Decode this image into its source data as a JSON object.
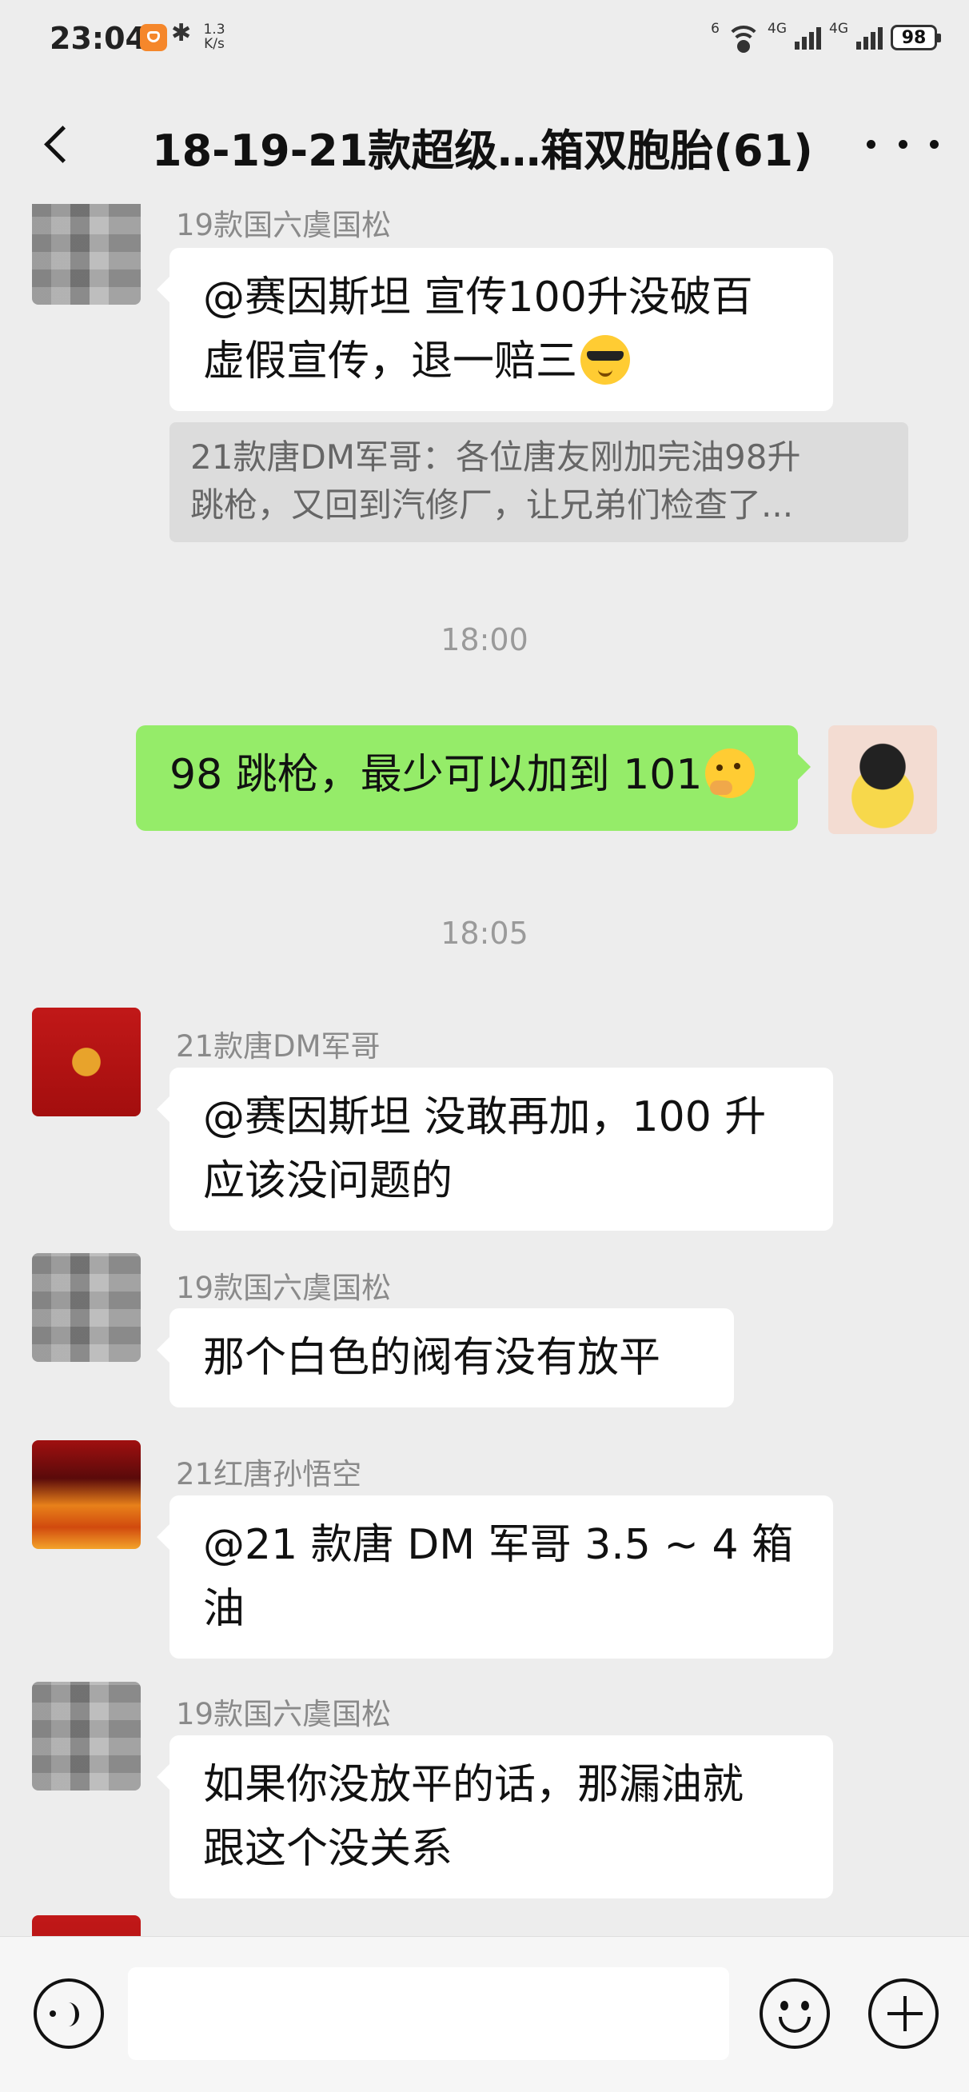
{
  "status_bar": {
    "time": "23:04",
    "net_speed": "1.3\nK/s",
    "net_tag": "6",
    "sim1_tag": "4G",
    "sim2_tag": "4G",
    "battery": "98",
    "icons": [
      "app-notification-icon",
      "bluetooth-icon",
      "wifi-icon",
      "signal-icon",
      "battery-icon"
    ]
  },
  "header": {
    "title": "18-19-21款超级…箱双胞胎(61)"
  },
  "messages": [
    {
      "sender": "19款国六虞国松",
      "text": "@赛因斯坦  宣传100升没破百虚假宣传，退一赔三",
      "emoji": "cool-face-icon",
      "quote": {
        "line1": "21款唐DM军哥：各位唐友刚加完油98升",
        "line2": "跳枪，又回到汽修厂，让兄弟们检查了..."
      }
    },
    {
      "timestamp": "18:00"
    },
    {
      "self": true,
      "text": "98 跳枪，最少可以加到 101",
      "emoji": "thinking-face-icon"
    },
    {
      "timestamp": "18:05"
    },
    {
      "sender": "21款唐DM军哥",
      "text": "@赛因斯坦  没敢再加，100 升应该没问题的"
    },
    {
      "sender": "19款国六虞国松",
      "text": "那个白色的阀有没有放平"
    },
    {
      "sender": "21红唐孙悟空",
      "text": "@21 款唐 DM 军哥  3.5 ~ 4 箱油"
    },
    {
      "sender": "19款国六虞国松",
      "text": "如果你没放平的话，那漏油就跟这个没关系"
    }
  ],
  "msg1_line1": "@赛因斯坦  宣传100升没破百",
  "msg1_line2": "虚假宣传，退一赔三",
  "msg5_line1": "@赛因斯坦  没敢再加，100 升",
  "msg5_line2": "应该没问题的",
  "msg7_line1": "@21 款唐 DM 军哥  3.5 ~ 4 箱",
  "msg7_line2": "油",
  "msg8_line1": "如果你没放平的话，那漏油就",
  "msg8_line2": "跟这个没关系",
  "input_bar": {
    "value": "",
    "icons": [
      "voice-icon",
      "emoji-icon",
      "plus-icon"
    ]
  }
}
